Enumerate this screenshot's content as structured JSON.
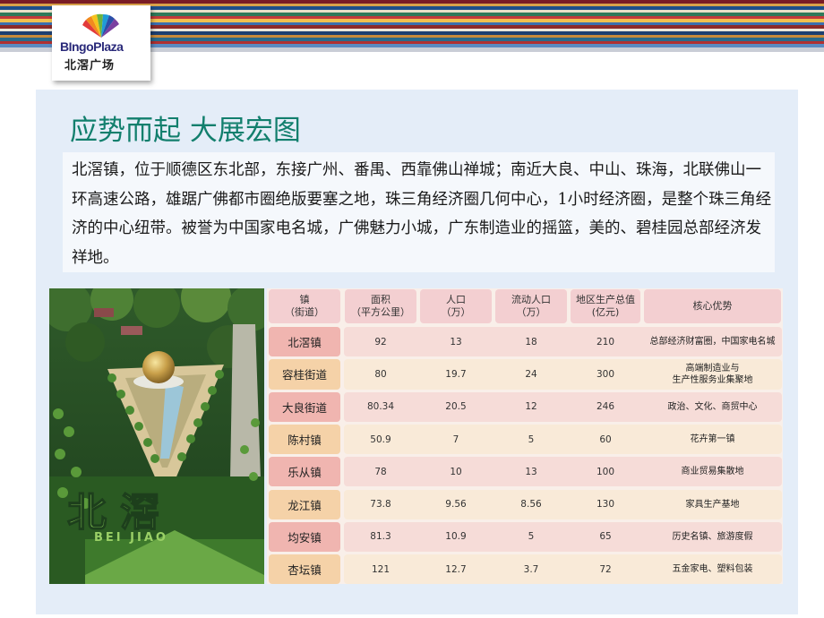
{
  "logo": {
    "brand_en": "BIngoPlaza",
    "brand_cn": "北滘广场"
  },
  "title": "应势而起 大展宏图",
  "intro": "北滘镇，位于顺德区东北部，东接广州、番禺、西靠佛山禅城；南近大良、中山、珠海，北联佛山一环高速公路，雄踞广佛都市圈绝版要塞之地，珠三角经济圈几何中心，1小时经济圈，是整个珠三角经济的中心纽带。被誉为中国家电名城，广佛魅力小城，广东制造业的摇篮，美的、碧桂园总部经济发祥地。",
  "photo": {
    "sign_cn": "北 滘",
    "sign_en": "BEI JIAO"
  },
  "table": {
    "headers": [
      {
        "line1": "镇",
        "line2": "（街道）"
      },
      {
        "line1": "面积",
        "line2": "（平方公里）"
      },
      {
        "line1": "人口",
        "line2": "（万）"
      },
      {
        "line1": "流动人口",
        "line2": "（万）"
      },
      {
        "line1": "地区生产总值",
        "line2": "(亿元)"
      },
      {
        "line1": "核心优势",
        "line2": ""
      }
    ],
    "rows": [
      {
        "town": "北滘镇",
        "area": "92",
        "pop": "13",
        "float": "18",
        "gdp": "210",
        "adv1": "总部经济财富圈，中国家电名城",
        "adv2": ""
      },
      {
        "town": "容桂街道",
        "area": "80",
        "pop": "19.7",
        "float": "24",
        "gdp": "300",
        "adv1": "高端制造业与",
        "adv2": "生产性服务业集聚地"
      },
      {
        "town": "大良街道",
        "area": "80.34",
        "pop": "20.5",
        "float": "12",
        "gdp": "246",
        "adv1": "政治、文化、商贸中心",
        "adv2": ""
      },
      {
        "town": "陈村镇",
        "area": "50.9",
        "pop": "7",
        "float": "5",
        "gdp": "60",
        "adv1": "花卉第一镇",
        "adv2": ""
      },
      {
        "town": "乐从镇",
        "area": "78",
        "pop": "10",
        "float": "13",
        "gdp": "100",
        "adv1": "商业贸易集散地",
        "adv2": ""
      },
      {
        "town": "龙江镇",
        "area": "73.8",
        "pop": "9.56",
        "float": "8.56",
        "gdp": "130",
        "adv1": "家具生产基地",
        "adv2": ""
      },
      {
        "town": "均安镇",
        "area": "81.3",
        "pop": "10.9",
        "float": "5",
        "gdp": "65",
        "adv1": "历史名镇、旅游度假",
        "adv2": ""
      },
      {
        "town": "杏坛镇",
        "area": "121",
        "pop": "12.7",
        "float": "3.7",
        "gdp": "72",
        "adv1": "五金家电、塑料包装",
        "adv2": ""
      }
    ]
  }
}
